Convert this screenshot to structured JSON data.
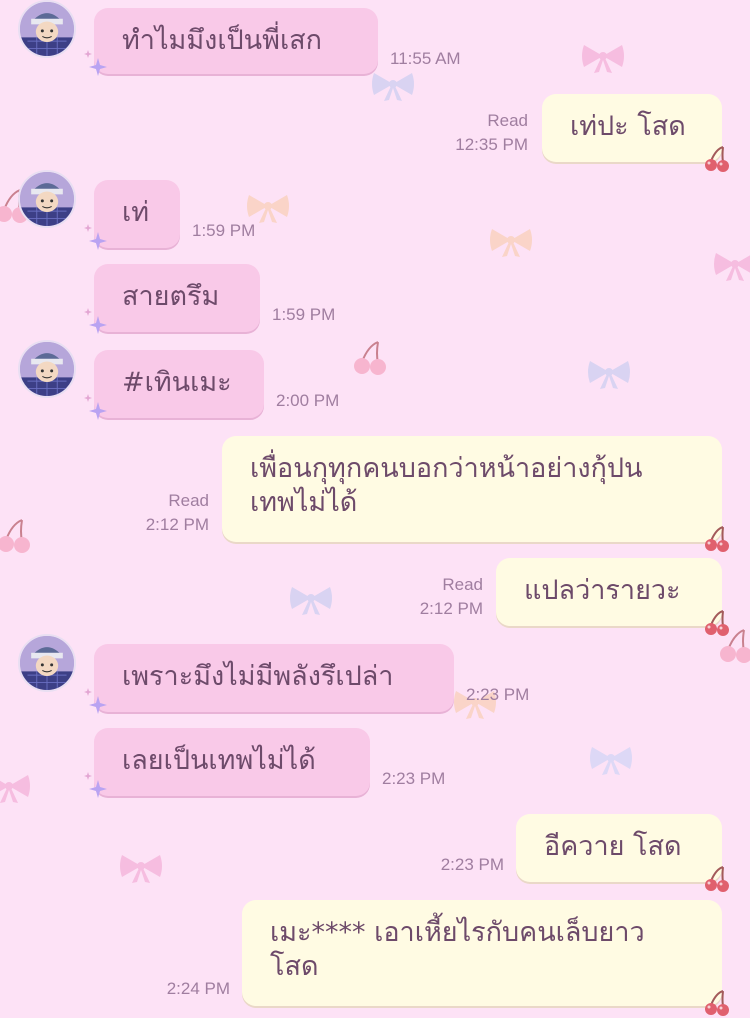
{
  "colors": {
    "background": "#fde2f6",
    "incoming_bubble": "#f9c9e8",
    "outgoing_bubble": "#fffbe3",
    "text": "#6d4a6a",
    "meta_text": "#a07ea0"
  },
  "messages": [
    {
      "direction": "in",
      "text": "ทำไมมึงเป็นพี่เสก",
      "time": "11:55 AM",
      "avatar": true
    },
    {
      "direction": "out",
      "text": "เท่ปะ โสด",
      "time": "12:35 PM",
      "read": "Read"
    },
    {
      "direction": "in",
      "text": "เท่",
      "time": "1:59 PM",
      "avatar": true
    },
    {
      "direction": "in",
      "text": "สายตรึม",
      "time": "1:59 PM"
    },
    {
      "direction": "in",
      "text": "#เทินเมะ",
      "time": "2:00 PM",
      "avatar": true
    },
    {
      "direction": "out",
      "text_lines": [
        "เพื่อนกุทุกคนบอกว่าหน้าอย่างกุ้ปน",
        "เทพไม่ได้"
      ],
      "time": "2:12 PM",
      "read": "Read"
    },
    {
      "direction": "out",
      "text": "แปลว่ารายวะ",
      "time": "2:12 PM",
      "read": "Read"
    },
    {
      "direction": "in",
      "text": "เพราะมึงไม่มีพลังรึเปล่า",
      "time": "2:23 PM",
      "avatar": true
    },
    {
      "direction": "in",
      "text": "เลยเป็นเทพไม่ได้",
      "time": "2:23 PM"
    },
    {
      "direction": "out",
      "text": "อีควาย โสด",
      "time": "2:23 PM"
    },
    {
      "direction": "out",
      "text_lines": [
        "เมะ**** เอาเหี้ยไรกับคนเล็บยาว",
        "โสด"
      ],
      "time": "2:24 PM"
    }
  ]
}
